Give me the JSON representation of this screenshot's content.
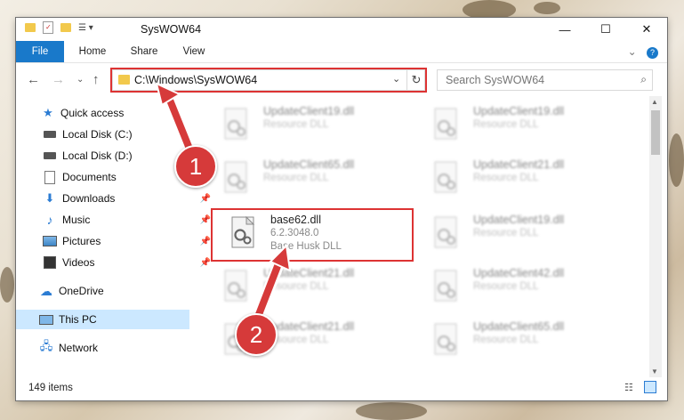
{
  "window": {
    "title": "SysWOW64"
  },
  "ribbon": {
    "tabs": [
      "File",
      "Home",
      "Share",
      "View"
    ]
  },
  "address": {
    "path": "C:\\Windows\\SysWOW64"
  },
  "search": {
    "placeholder": "Search SysWOW64"
  },
  "sidebar": {
    "items": [
      {
        "label": "Quick access",
        "icon": "star-icon"
      },
      {
        "label": "Local Disk (C:)",
        "icon": "drive-icon"
      },
      {
        "label": "Local Disk (D:)",
        "icon": "drive-icon"
      },
      {
        "label": "Documents",
        "icon": "documents-icon"
      },
      {
        "label": "Downloads",
        "icon": "download-icon"
      },
      {
        "label": "Music",
        "icon": "music-icon"
      },
      {
        "label": "Pictures",
        "icon": "pictures-icon"
      },
      {
        "label": "Videos",
        "icon": "videos-icon"
      },
      {
        "label": "OneDrive",
        "icon": "cloud-icon"
      },
      {
        "label": "This PC",
        "icon": "computer-icon"
      },
      {
        "label": "Network",
        "icon": "network-icon"
      }
    ]
  },
  "files": [
    {
      "name": "UpdateClient19.dll",
      "desc": "Resource DLL",
      "version": ""
    },
    {
      "name": "UpdateClient19.dll",
      "desc": "Resource DLL",
      "version": ""
    },
    {
      "name": "UpdateClient65.dll",
      "desc": "Resource DLL",
      "version": ""
    },
    {
      "name": "UpdateClient21.dll",
      "desc": "Resource DLL",
      "version": ""
    },
    {
      "name": "base62.dll",
      "desc": "Base Husk DLL",
      "version": "6.2.3048.0"
    },
    {
      "name": "UpdateClient19.dll",
      "desc": "Resource DLL",
      "version": ""
    },
    {
      "name": "UpdateClient21.dll",
      "desc": "Resource DLL",
      "version": ""
    },
    {
      "name": "UpdateClient42.dll",
      "desc": "Resource DLL",
      "version": ""
    },
    {
      "name": "UpdateClient21.dll",
      "desc": "Resource DLL",
      "version": ""
    },
    {
      "name": "UpdateClient65.dll",
      "desc": "Resource DLL",
      "version": ""
    }
  ],
  "status": {
    "count": "149 items"
  },
  "callouts": [
    "1",
    "2"
  ],
  "colors": {
    "accent": "#1979ca",
    "highlight": "#d33333",
    "selected": "#cce8ff"
  }
}
